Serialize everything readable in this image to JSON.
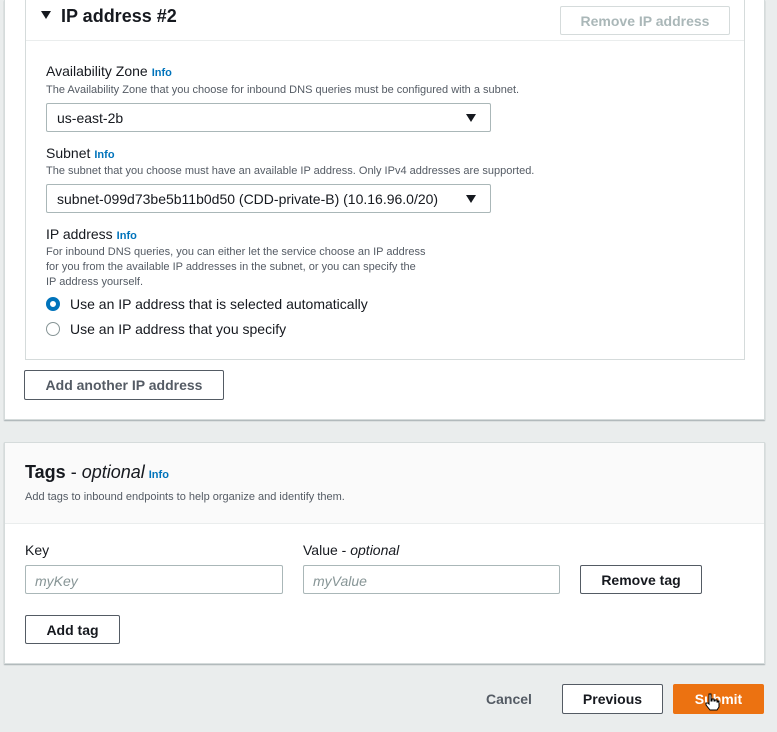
{
  "ip_section": {
    "title": "IP address #2",
    "remove_button": "Remove IP address",
    "availability_zone": {
      "label": "Availability Zone",
      "info": "Info",
      "description": "The Availability Zone that you choose for inbound DNS queries must be configured with a subnet.",
      "value": "us-east-2b"
    },
    "subnet": {
      "label": "Subnet",
      "info": "Info",
      "description": "The subnet that you choose must have an available IP address. Only IPv4 addresses are supported.",
      "value": "subnet-099d73be5b11b0d50 (CDD-private-B) (10.16.96.0/20)"
    },
    "ip_address": {
      "label": "IP address",
      "info": "Info",
      "description_lines": [
        "For inbound DNS queries, you can either let the service choose an IP address",
        "for you from the available IP addresses in the subnet, or you can specify the",
        "IP address yourself."
      ],
      "options": [
        {
          "label": "Use an IP address that is selected automatically",
          "checked": true
        },
        {
          "label": "Use an IP address that you specify",
          "checked": false
        }
      ]
    },
    "add_another_button": "Add another IP address"
  },
  "tags": {
    "title": "Tags",
    "title_dash": " - ",
    "title_optional": "optional",
    "info": "Info",
    "description": "Add tags to inbound endpoints to help organize and identify them.",
    "key_label": "Key",
    "value_label": "Value",
    "value_optional": "optional",
    "value_dash": " - ",
    "key_placeholder": "myKey",
    "value_placeholder": "myValue",
    "remove_tag_button": "Remove tag",
    "add_tag_button": "Add tag"
  },
  "footer": {
    "cancel": "Cancel",
    "previous": "Previous",
    "submit": "Submit"
  },
  "colors": {
    "accent": "#ec7211",
    "link": "#0073bb",
    "background": "#eaeded"
  }
}
